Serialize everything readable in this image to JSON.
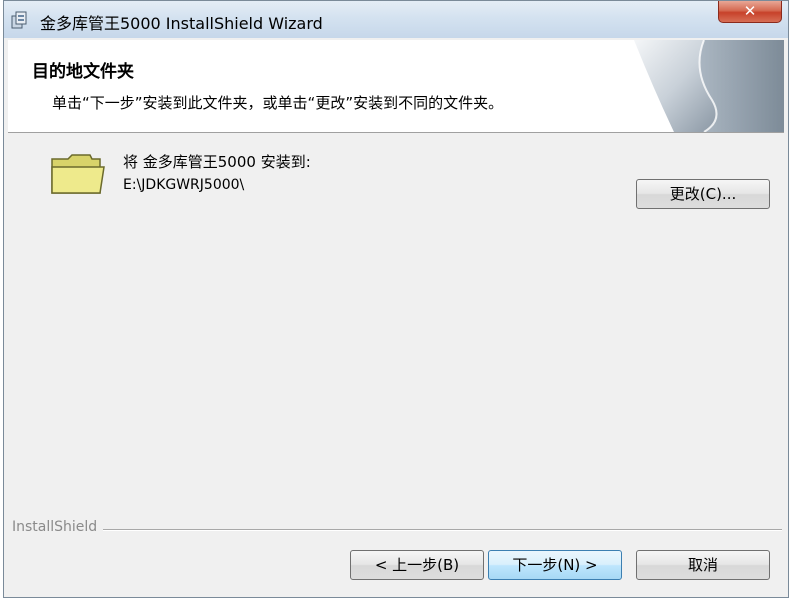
{
  "window": {
    "title": "金多库管王5000 InstallShield Wizard",
    "close_glyph": "✕"
  },
  "header": {
    "title": "目的地文件夹",
    "subtitle": "单击“下一步”安装到此文件夹，或单击“更改”安装到不同的文件夹。"
  },
  "destination": {
    "label": "将 金多库管王5000 安装到:",
    "path": "E:\\JDKGWRJ5000\\",
    "change_button": "更改(C)..."
  },
  "footer": {
    "brand": "InstallShield",
    "back_button": "< 上一步(B)",
    "next_button": "下一步(N) >",
    "cancel_button": "取消"
  },
  "colors": {
    "window_bg": "#f0f0f0",
    "header_bg": "#ffffff",
    "default_button_border": "#3c7fb1",
    "close_button": "#c7412a",
    "folder": "#e6e27a"
  }
}
